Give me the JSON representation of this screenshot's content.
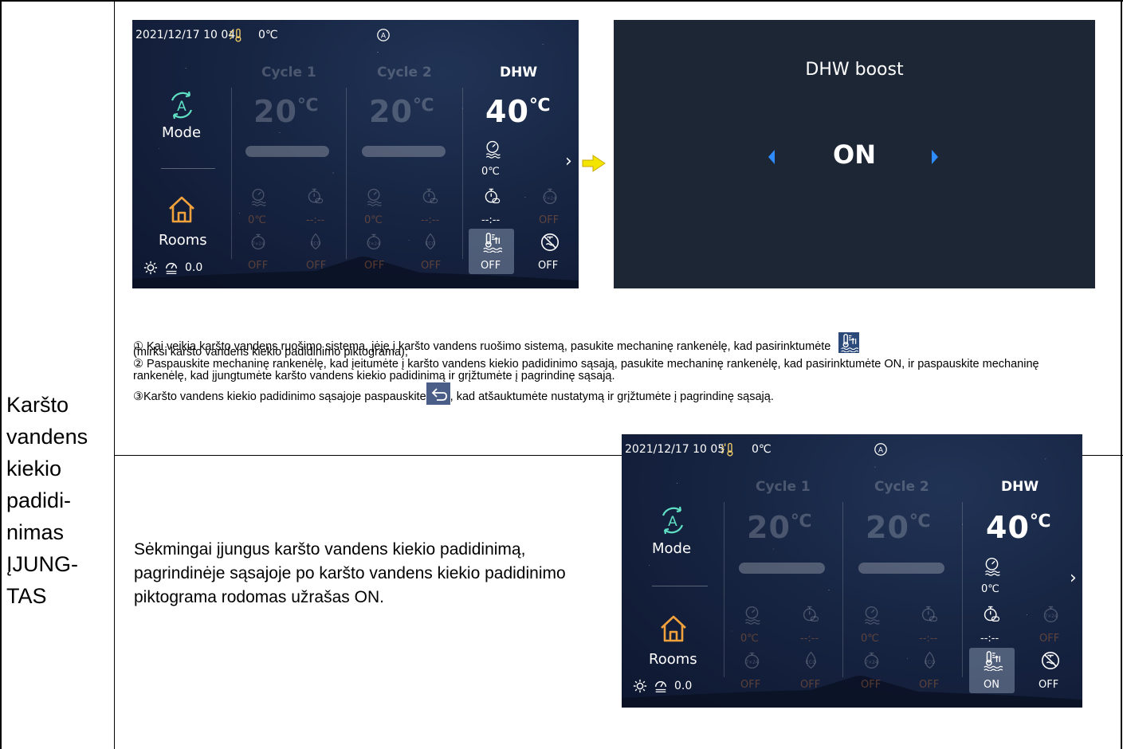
{
  "left_label": [
    "Karšto",
    "vandens",
    "kiekio",
    "padidi-",
    "nimas",
    "ĮJUNG-",
    "TAS"
  ],
  "screen1": {
    "datetime": "2021/12/17 10 04",
    "outdoor_temp": "0℃",
    "mode_glyph": "A",
    "cycle1_title": "Cycle 1",
    "cycle2_title": "Cycle 2",
    "dhw_title": "DHW",
    "cycle1_temp": "20",
    "cycle2_temp": "20",
    "dhw_temp": "40",
    "unit": "℃",
    "mode_label": "Mode",
    "rooms_label": "Rooms",
    "pressure": "0.0",
    "dhw_sensor_temp": "0℃",
    "dhw_timer": "--:--",
    "dhw_week_status": "OFF",
    "dhw_boost_status": "OFF",
    "dhw_disinfect_status": "OFF",
    "cycle1_temp_small": "0℃",
    "cycle1_timer": "--:--",
    "cycle1_week": "OFF",
    "cycle1_eco": "OFF",
    "cycle2_temp_small": "0℃",
    "cycle2_timer": "--:--",
    "cycle2_week": "OFF",
    "cycle2_eco": "OFF",
    "eco_glyph": "ECO",
    "week_glyph": "7×24"
  },
  "boost_screen": {
    "title": "DHW boost",
    "value": "ON"
  },
  "instructions": {
    "step1": "① Kai veikia karšto vandens ruošimo sistema, įėję į karšto vandens ruošimo sistemą, pasukite mechaninę rankenėlę, kad pasirinktumėte",
    "step1_cont": "(mirksi karšto vandens kiekio padidinimo piktograma);",
    "step2": "② Paspauskite mechaninę rankenėlę, kad įeitumėte į karšto vandens kiekio padidinimo sąsają, pasukite mechaninę rankenėlę, kad pasirinktumėte ON, ir paspauskite mechaninę rankenėlę, kad įjungtumėte karšto vandens kiekio padidinimą ir grįžtumėte į pagrindinę sąsają.",
    "step3_a": "③Karšto vandens kiekio padidinimo sąsajoje paspauskite",
    "step3_b": ", kad atšauktumėte nustatymą ir grįžtumėte į pagrindinę sąsają."
  },
  "success_text": "Sėkmingai įjungus karšto vandens kiekio padidinimą, pagrindinėje sąsajoje po karšto vandens kiekio padidinimo piktograma rodomas užrašas ON.",
  "screen2": {
    "datetime": "2021/12/17 10 05",
    "outdoor_temp": "0℃",
    "mode_glyph": "A",
    "cycle1_title": "Cycle 1",
    "cycle2_title": "Cycle 2",
    "dhw_title": "DHW",
    "cycle1_temp": "20",
    "cycle2_temp": "20",
    "dhw_temp": "40",
    "unit": "℃",
    "mode_label": "Mode",
    "rooms_label": "Rooms",
    "pressure": "0.0",
    "dhw_sensor_temp": "0℃",
    "dhw_timer": "--:--",
    "dhw_week_status": "OFF",
    "dhw_boost_status": "ON",
    "dhw_disinfect_status": "OFF",
    "cycle1_temp_small": "0℃",
    "cycle1_timer": "--:--",
    "cycle1_week": "OFF",
    "cycle1_eco": "OFF",
    "cycle2_temp_small": "0℃",
    "cycle2_timer": "--:--",
    "cycle2_week": "OFF",
    "cycle2_eco": "OFF",
    "eco_glyph": "ECO",
    "week_glyph": "7×24"
  },
  "colors": {
    "arrow_yellow": "#f3e500",
    "boost_bg": "#1d2635",
    "nav_blue": "#2f8cff",
    "home_orange": "#f2a23c"
  }
}
